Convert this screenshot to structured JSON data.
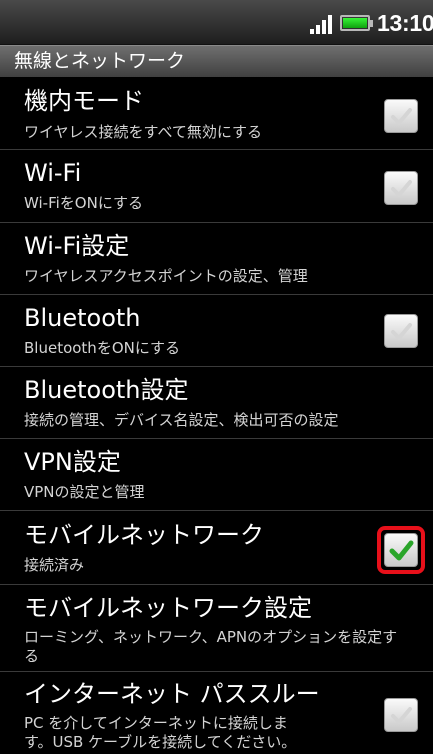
{
  "status_bar": {
    "time": "13:10",
    "icons": [
      "signal-icon",
      "battery-icon"
    ],
    "battery_color": "#1fc51f"
  },
  "section_header": "無線とネットワーク",
  "highlight_color": "#e8101a",
  "items": [
    {
      "title": "機内モード",
      "summary": "ワイヤレス接続をすべて無効にする",
      "checked": false
    },
    {
      "title": "Wi-Fi",
      "summary": "Wi-FiをONにする",
      "checked": false
    },
    {
      "title": "Wi-Fi設定",
      "summary": "ワイヤレスアクセスポイントの設定、管理"
    },
    {
      "title": "Bluetooth",
      "summary": "BluetoothをONにする",
      "checked": false
    },
    {
      "title": "Bluetooth設定",
      "summary": "接続の管理、デバイス名設定、検出可否の設定"
    },
    {
      "title": "VPN設定",
      "summary": "VPNの設定と管理"
    },
    {
      "title": "モバイルネットワーク",
      "summary": "接続済み",
      "checked": true
    },
    {
      "title": "モバイルネットワーク設定",
      "summary_line1": "ローミング、ネットワーク、APNのオプションを設定す",
      "summary_line2": "る"
    },
    {
      "title": "インターネット パススルー",
      "summary_line1": "PC を介してインターネットに接続しま",
      "summary_line2": "す。USB ケーブルを接続してください。",
      "checked": false
    }
  ]
}
